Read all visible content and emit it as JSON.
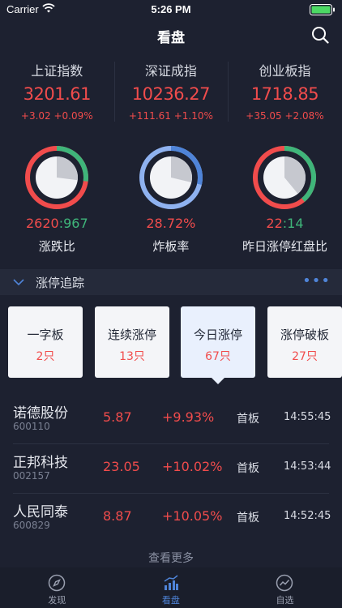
{
  "status_bar": {
    "carrier": "Carrier",
    "time": "5:26 PM"
  },
  "nav": {
    "title": "看盘"
  },
  "indices": [
    {
      "name": "上证指数",
      "value": "3201.61",
      "change": "+3.02  +0.09%"
    },
    {
      "name": "深证成指",
      "value": "10236.27",
      "change": "+111.61  +1.10%"
    },
    {
      "name": "创业板指",
      "value": "1718.85",
      "change": "+35.05  +2.08%"
    }
  ],
  "gauges": [
    {
      "value_red": "2620",
      "sep": ":",
      "value_green": "967",
      "label": "涨跌比",
      "ratio": 0.27,
      "kind": "ratio"
    },
    {
      "value": "28.72%",
      "label": "炸板率",
      "ratio": 0.2872,
      "kind": "rate"
    },
    {
      "value_red": "22",
      "sep": ":",
      "value_green": "14",
      "label": "昨日涨停红盘比",
      "ratio": 0.39,
      "kind": "ratio"
    }
  ],
  "section": {
    "title": "涨停追踪",
    "more": "•••"
  },
  "categories": [
    {
      "name": "一字板",
      "count": "2只"
    },
    {
      "name": "连续涨停",
      "count": "13只"
    },
    {
      "name": "今日涨停",
      "count": "67只",
      "active": true
    },
    {
      "name": "涨停破板",
      "count": "27只"
    }
  ],
  "stocks": [
    {
      "name": "诺德股份",
      "code": "600110",
      "price": "5.87",
      "pct": "+9.93%",
      "tag": "首板",
      "time": "14:55:45"
    },
    {
      "name": "正邦科技",
      "code": "002157",
      "price": "23.05",
      "pct": "+10.02%",
      "tag": "首板",
      "time": "14:53:44"
    },
    {
      "name": "人民同泰",
      "code": "600829",
      "price": "8.87",
      "pct": "+10.05%",
      "tag": "首板",
      "time": "14:52:45"
    }
  ],
  "view_more": "查看更多",
  "tabs": [
    {
      "label": "发现",
      "icon": "compass-icon"
    },
    {
      "label": "看盘",
      "icon": "bar-chart-icon",
      "active": true
    },
    {
      "label": "自选",
      "icon": "trend-icon"
    }
  ],
  "colors": {
    "red": "#f14c4c",
    "green": "#3fb57a",
    "blue": "#4f84d8",
    "background": "#1d2130"
  }
}
